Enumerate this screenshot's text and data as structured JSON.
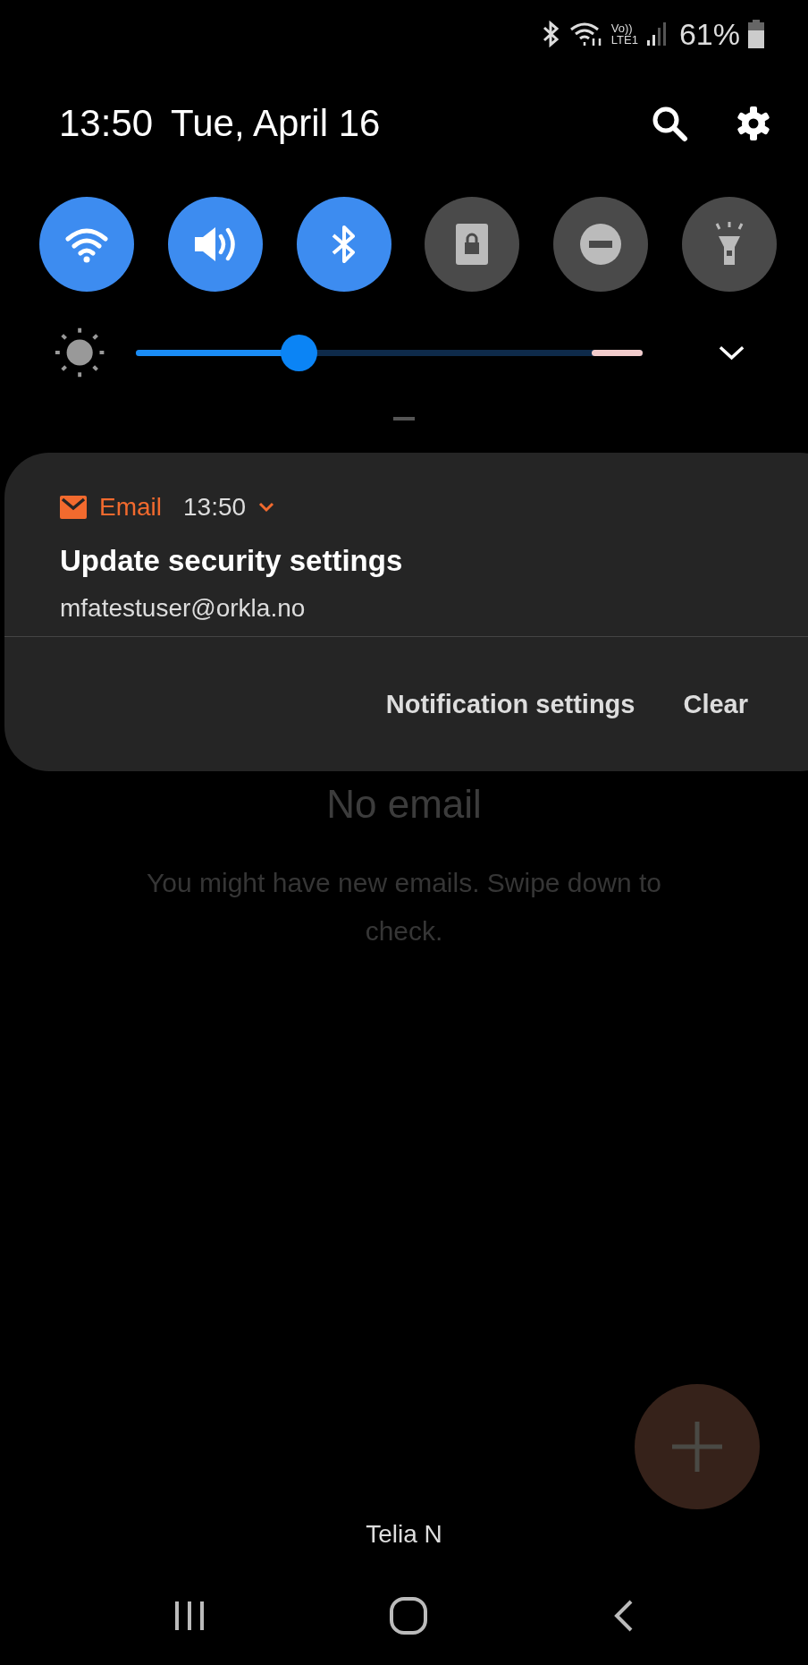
{
  "status_bar": {
    "volte_top": "Vo))",
    "volte_bottom": "LTE1",
    "battery": "61%"
  },
  "header": {
    "time": "13:50",
    "date": "Tue, April 16"
  },
  "quick_toggles": [
    {
      "kind": "wifi",
      "on": true
    },
    {
      "kind": "sound",
      "on": true
    },
    {
      "kind": "bluetooth",
      "on": true
    },
    {
      "kind": "rotation-lock",
      "on": false
    },
    {
      "kind": "do-not-disturb",
      "on": false
    },
    {
      "kind": "flashlight",
      "on": false
    }
  ],
  "brightness": {
    "level": 0.32
  },
  "notification": {
    "app": "Email",
    "time": "13:50",
    "title": "Update security settings",
    "text": "mfatestuser@orkla.no",
    "actions": [
      "Notification settings",
      "Clear"
    ]
  },
  "background_app": {
    "empty_title": "No email",
    "empty_text": "You might have new emails. Swipe down to check."
  },
  "carrier": "Telia N"
}
